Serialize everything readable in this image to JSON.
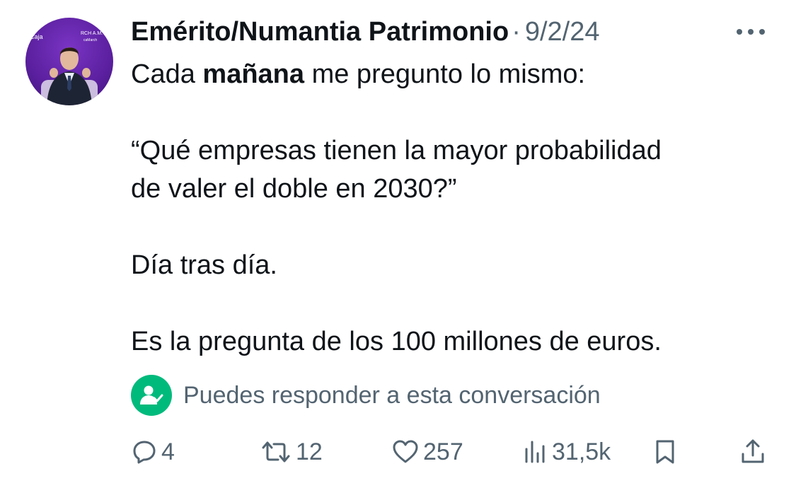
{
  "tweet": {
    "author": "Emérito/Numantia Patrimonio",
    "separator": "·",
    "date": "9/2/24",
    "avatar": {
      "texts": [
        "Caja",
        "RCH A.M.",
        "caMarch"
      ]
    },
    "text": {
      "line1_before": "Cada ",
      "line1_bold": "mañana",
      "line1_after": " me pregunto lo mismo:",
      "line2": "“Qué empresas tienen la mayor probabilidad",
      "line3": "de valer el doble en 2030?”",
      "line4": "Día tras día.",
      "line5": "Es la pregunta de los 100 millones de euros."
    }
  },
  "reply_notice": {
    "icon": "person-check-icon",
    "text": "Puedes responder a esta conversación",
    "badge_color": "#00ba7c"
  },
  "actions": {
    "reply": {
      "icon": "reply-icon",
      "count": "4"
    },
    "retweet": {
      "icon": "retweet-icon",
      "count": "12"
    },
    "like": {
      "icon": "heart-icon",
      "count": "257"
    },
    "views": {
      "icon": "views-icon",
      "count": "31,5k"
    },
    "bookmark": {
      "icon": "bookmark-icon"
    },
    "share": {
      "icon": "share-icon"
    }
  },
  "colors": {
    "text_primary": "#0f1419",
    "text_secondary": "#536471",
    "avatar_background": "#5a1f9e"
  }
}
